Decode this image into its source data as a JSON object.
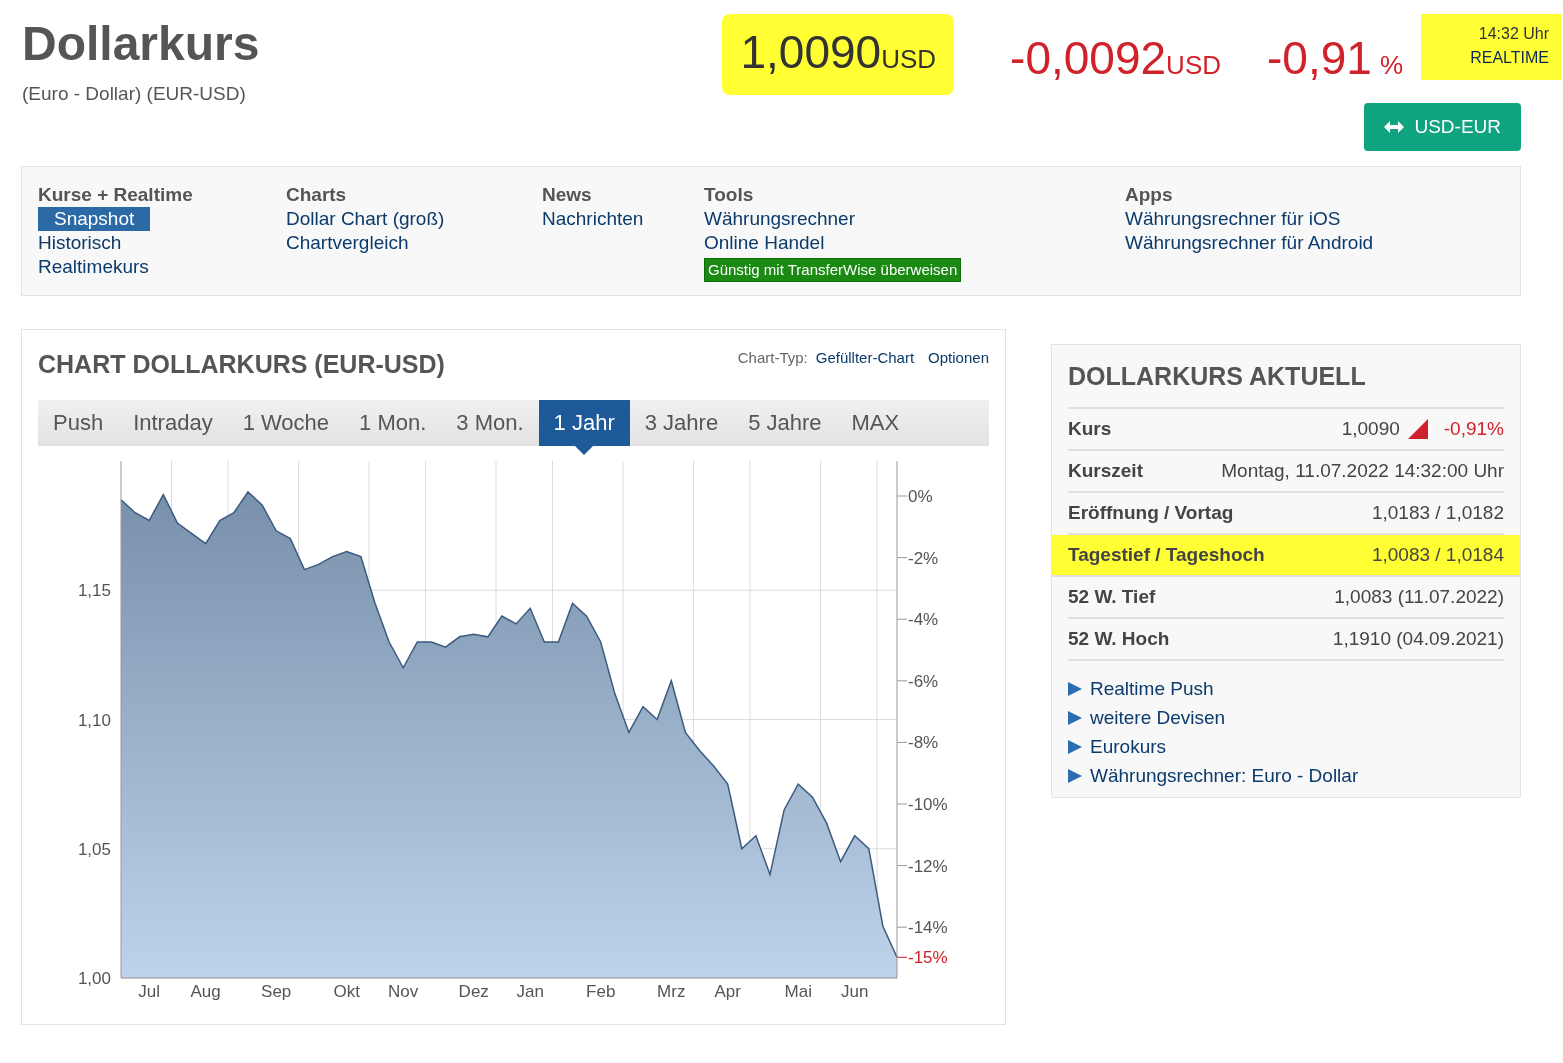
{
  "header": {
    "title": "Dollarkurs",
    "subtitle": "(Euro - Dollar) (EUR-USD)",
    "price": {
      "value": "1,0090",
      "unit": "USD",
      "highlighted": true
    },
    "change": {
      "value": "-0,0092",
      "unit": "USD"
    },
    "change_pct": {
      "value": "-0,91",
      "unit": "%"
    },
    "time": {
      "clock": "14:32 Uhr",
      "label": "REALTIME",
      "highlighted": true
    },
    "swap_button": "USD-EUR"
  },
  "nav": [
    {
      "heading": "Kurse + Realtime",
      "items": [
        {
          "label": "Snapshot",
          "kind": "link",
          "selected": true
        },
        {
          "label": "Historisch",
          "kind": "link",
          "selected": false
        },
        {
          "label": "Realtimekurs",
          "kind": "link",
          "selected": false
        }
      ]
    },
    {
      "heading": "Charts",
      "items": [
        {
          "label": "Dollar Chart (groß)",
          "kind": "link",
          "selected": false
        },
        {
          "label": "Chartvergleich",
          "kind": "link",
          "selected": false
        }
      ]
    },
    {
      "heading": "News",
      "items": [
        {
          "label": "Nachrichten",
          "kind": "link",
          "selected": false
        }
      ]
    },
    {
      "heading": "Tools",
      "items": [
        {
          "label": "Währungsrechner",
          "kind": "link",
          "selected": false
        },
        {
          "label": "Online Handel",
          "kind": "link",
          "selected": false
        },
        {
          "label": "Günstig mit TransferWise überweisen",
          "kind": "promo"
        }
      ]
    },
    {
      "heading": "Apps",
      "items": [
        {
          "label": "Währungsrechner für iOS",
          "kind": "link",
          "selected": false
        },
        {
          "label": "Währungsrechner für Android",
          "kind": "link",
          "selected": false
        }
      ]
    }
  ],
  "chart_panel": {
    "title": "CHART DOLLARKURS (EUR-USD)",
    "chart_type_label": "Chart-Typ:",
    "chart_type": "Gefüllter-Chart",
    "options": "Optionen",
    "tabs": [
      {
        "label": "Push",
        "selected": false
      },
      {
        "label": "Intraday",
        "selected": false
      },
      {
        "label": "1 Woche",
        "selected": false
      },
      {
        "label": "1 Mon.",
        "selected": false
      },
      {
        "label": "3 Mon.",
        "selected": false
      },
      {
        "label": "1 Jahr",
        "selected": true
      },
      {
        "label": "3 Jahre",
        "selected": false
      },
      {
        "label": "5 Jahre",
        "selected": false
      },
      {
        "label": "MAX",
        "selected": false
      }
    ],
    "chart_data": {
      "type": "area",
      "grid": true,
      "ylim": [
        1.0,
        1.2
      ],
      "categories": [
        null,
        null,
        "Jul",
        null,
        null,
        null,
        "Aug",
        null,
        null,
        null,
        null,
        "Sep",
        null,
        null,
        null,
        null,
        "Okt",
        null,
        null,
        null,
        "Nov",
        null,
        null,
        null,
        null,
        "Dez",
        null,
        null,
        null,
        "Jan",
        null,
        null,
        null,
        null,
        "Feb",
        null,
        null,
        null,
        null,
        "Mrz",
        null,
        null,
        null,
        "Apr",
        null,
        null,
        null,
        null,
        "Mai",
        null,
        null,
        null,
        "Jun",
        null,
        null,
        null
      ],
      "yticks": [
        {
          "value": 1.0,
          "label": "1,00"
        },
        {
          "value": 1.05,
          "label": "1,05"
        },
        {
          "value": 1.1,
          "label": "1,10"
        },
        {
          "value": 1.15,
          "label": "1,15"
        }
      ],
      "y2ticks": [
        "0%",
        "-2%",
        "-4%",
        "-6%",
        "-8%",
        "-10%",
        "-12%",
        "-14%"
      ],
      "annotations": [
        "-15%"
      ],
      "series": [
        {
          "color": "#3b5a80",
          "values": [
            1.185,
            1.18,
            1.177,
            1.187,
            1.176,
            1.172,
            1.168,
            1.177,
            1.18,
            1.188,
            1.183,
            1.173,
            1.17,
            1.158,
            1.16,
            1.163,
            1.165,
            1.163,
            1.145,
            1.13,
            1.12,
            1.13,
            1.13,
            1.128,
            1.132,
            1.133,
            1.132,
            1.14,
            1.137,
            1.143,
            1.13,
            1.13,
            1.145,
            1.14,
            1.13,
            1.11,
            1.095,
            1.105,
            1.1,
            1.115,
            1.095,
            1.088,
            1.082,
            1.075,
            1.05,
            1.055,
            1.04,
            1.065,
            1.075,
            1.07,
            1.06,
            1.045,
            1.055,
            1.05,
            1.02,
            1.008
          ]
        }
      ]
    }
  },
  "side_panel": {
    "title": "DOLLARKURS AKTUELL",
    "rows": [
      {
        "label": "Kurs",
        "value": "1,0090",
        "change": "-0,91%",
        "highlighted": false
      },
      {
        "label": "Kurszeit",
        "value": "Montag, 11.07.2022 14:32:00 Uhr",
        "highlighted": false
      },
      {
        "label": "Eröffnung / Vortag",
        "value": "1,0183 / 1,0182",
        "highlighted": false
      },
      {
        "label": "Tagestief / Tageshoch",
        "value": "1,0083 / 1,0184",
        "highlighted": true
      },
      {
        "label": "52 W. Tief",
        "value": "1,0083 (11.07.2022)",
        "highlighted": false
      },
      {
        "label": "52 W. Hoch",
        "value": "1,1910 (04.09.2021)",
        "highlighted": false
      }
    ],
    "links": [
      "Realtime Push",
      "weitere Devisen",
      "Eurokurs",
      "Währungsrechner: Euro - Dollar"
    ]
  }
}
